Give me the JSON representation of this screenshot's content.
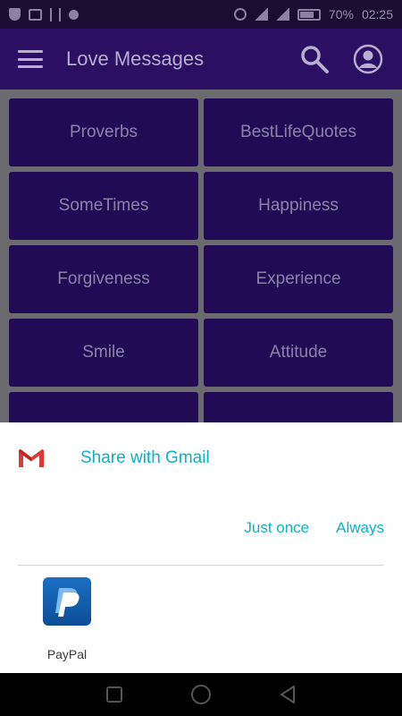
{
  "status_bar": {
    "battery": "70%",
    "time": "02:25"
  },
  "app_bar": {
    "title": "Love Messages"
  },
  "categories": [
    "Proverbs",
    "BestLifeQuotes",
    "SomeTimes",
    "Happiness",
    "Forgiveness",
    "Experience",
    "Smile",
    "Attitude",
    "",
    ""
  ],
  "share_sheet": {
    "share_label": "Share with Gmail",
    "just_once": "Just once",
    "always": "Always",
    "apps": [
      {
        "label": "PayPal",
        "icon": "paypal-icon"
      }
    ]
  },
  "colors": {
    "app_bar": "#2a0f63",
    "tile": "#220b55",
    "accent": "#0fb0c7"
  }
}
